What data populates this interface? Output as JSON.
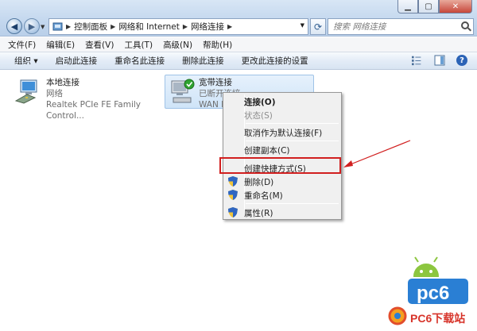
{
  "address": {
    "crumbs": [
      "控制面板",
      "网络和 Internet",
      "网络连接"
    ]
  },
  "search": {
    "placeholder": "搜索 网络连接"
  },
  "menu": [
    "文件(F)",
    "编辑(E)",
    "查看(V)",
    "工具(T)",
    "高级(N)",
    "帮助(H)"
  ],
  "commands": [
    "组织 ▾",
    "启动此连接",
    "重命名此连接",
    "删除此连接",
    "更改此连接的设置"
  ],
  "connections": {
    "local": {
      "name": "本地连接",
      "status": "网络",
      "device": "Realtek PCIe FE Family Control..."
    },
    "broadband": {
      "name": "宽带连接",
      "status": "已断开连接",
      "device": "WAN M"
    }
  },
  "context_menu": {
    "items": [
      "连接(O)",
      "状态(S)",
      "取消作为默认连接(F)",
      "创建副本(C)",
      "创建快捷方式(S)",
      "删除(D)",
      "重命名(M)",
      "属性(R)"
    ]
  },
  "logo": {
    "text": "pc6",
    "watermark": "PC6下载站"
  },
  "colors": {
    "highlight": "#d11f1f",
    "accent": "#2b63b6"
  }
}
